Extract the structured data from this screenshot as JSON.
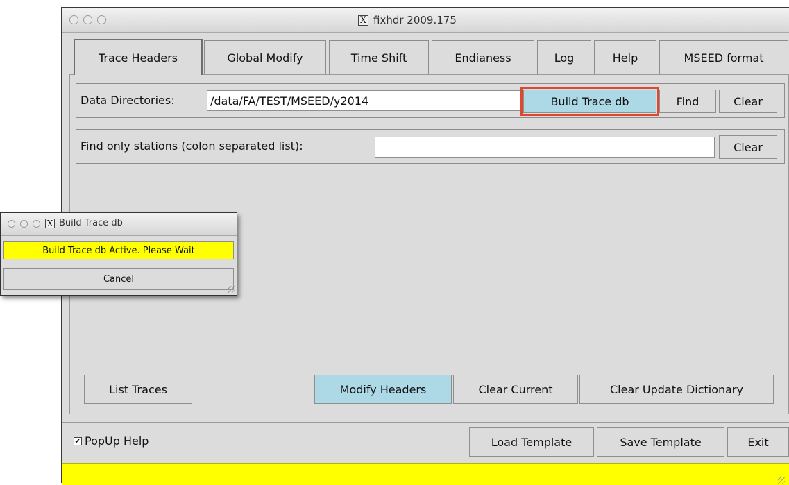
{
  "window": {
    "title": "fixhdr 2009.175",
    "x_glyph": "X"
  },
  "tabs": [
    {
      "label": "Trace Headers"
    },
    {
      "label": "Global Modify"
    },
    {
      "label": "Time Shift"
    },
    {
      "label": "Endianess"
    },
    {
      "label": "Log"
    },
    {
      "label": "Help"
    },
    {
      "label": "MSEED format"
    }
  ],
  "data_dirs": {
    "label": "Data Directories:",
    "value": "/data/FA/TEST/MSEED/y2014",
    "build_label": "Build Trace db",
    "find_label": "Find",
    "clear_label": "Clear"
  },
  "stations": {
    "label": "Find only stations (colon separated list):",
    "value": "",
    "clear_label": "Clear"
  },
  "actions": {
    "list_traces": "List Traces",
    "modify_headers": "Modify Headers",
    "clear_current": "Clear Current",
    "clear_update_dictionary": "Clear Update Dictionary"
  },
  "footer": {
    "popup_help_label": "PopUp Help",
    "popup_help_checked": true,
    "load_template": "Load Template",
    "save_template": "Save Template",
    "exit": "Exit",
    "status_text": ""
  },
  "popup": {
    "title": "Build Trace db",
    "x_glyph": "X",
    "message": "Build Trace db Active. Please Wait",
    "cancel_label": "Cancel"
  },
  "colors": {
    "active_button": "#add8e6",
    "status_bar": "#ffff00",
    "highlight_border": "#e0472f",
    "window_bg": "#dcdcdc"
  }
}
